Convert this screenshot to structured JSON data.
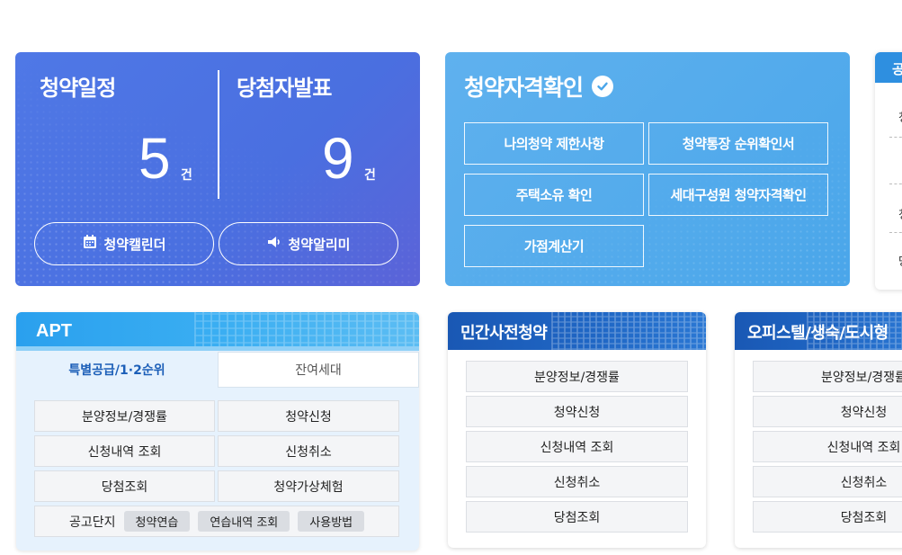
{
  "schedule": {
    "left_title": "청약일정",
    "left_count": "5",
    "left_unit": "건",
    "right_title": "당첨자발표",
    "right_count": "9",
    "right_unit": "건",
    "calendar_label": "청약캘린더",
    "alarm_label": "청약알리미"
  },
  "qualification": {
    "title": "청약자격확인",
    "buttons": [
      "나의청약 제한사항",
      "청약통장 순위확인서",
      "주택소유 확인",
      "세대구성원 청약자격확인",
      "가점계산기"
    ]
  },
  "partial_card": {
    "header": "공",
    "chars": [
      "청",
      "청",
      "당"
    ]
  },
  "apt": {
    "title": "APT",
    "tabs": [
      "특별공급/1·2순위",
      "잔여세대"
    ],
    "buttons": [
      "분양정보/경쟁률",
      "청약신청",
      "신청내역 조회",
      "신청취소",
      "당첨조회",
      "청약가상체험"
    ],
    "notice_label": "공고단지",
    "chips": [
      "청약연습",
      "연습내역 조회",
      "사용방법"
    ]
  },
  "private_pre": {
    "title": "민간사전청약",
    "items": [
      "분양정보/경쟁률",
      "청약신청",
      "신청내역 조회",
      "신청취소",
      "당첨조회"
    ]
  },
  "officetel": {
    "title": "오피스텔/생숙/도시형",
    "items": [
      "분양정보/경쟁률",
      "청약신청",
      "신청내역 조회",
      "신청취소",
      "당첨조회"
    ]
  },
  "colors": {
    "schedule_bg": "#4f78e6",
    "qualification_bg": "#4aa6ea",
    "apt_header": "#2aa0ee",
    "list_header": "#1a58b4",
    "apt_body": "#e6f2fd"
  }
}
